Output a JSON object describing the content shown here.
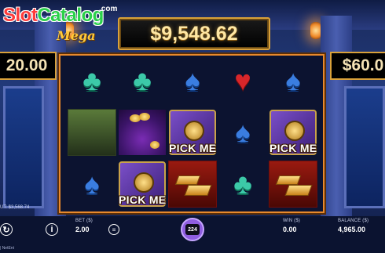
{
  "logo": {
    "name_red": "Slot",
    "name_green": "Catalog",
    "com": ".com",
    "sub": "Mega"
  },
  "jackpot": {
    "main": "$9,548.62",
    "left": "20.00",
    "right": "$60.0"
  },
  "reels": {
    "pick_label": "PICK ME"
  },
  "payout": "UT: $3,568.74",
  "bottom": {
    "bet_label": "BET ($)",
    "bet_value": "2.00",
    "spins": "224",
    "win_label": "WIN ($)",
    "win_value": "0.00",
    "balance_label": "BALANCE ($)",
    "balance_value": "4,965.00",
    "brand": "| NetEnt"
  },
  "colors": {
    "reel_border": "#e8892c",
    "spin_button": "#8f5ee0",
    "jackpot_text": "#ffe7a3"
  },
  "icons": {
    "autoplay": "autoplay-icon",
    "info": "info-icon",
    "coins": "coin-stack-icon"
  }
}
